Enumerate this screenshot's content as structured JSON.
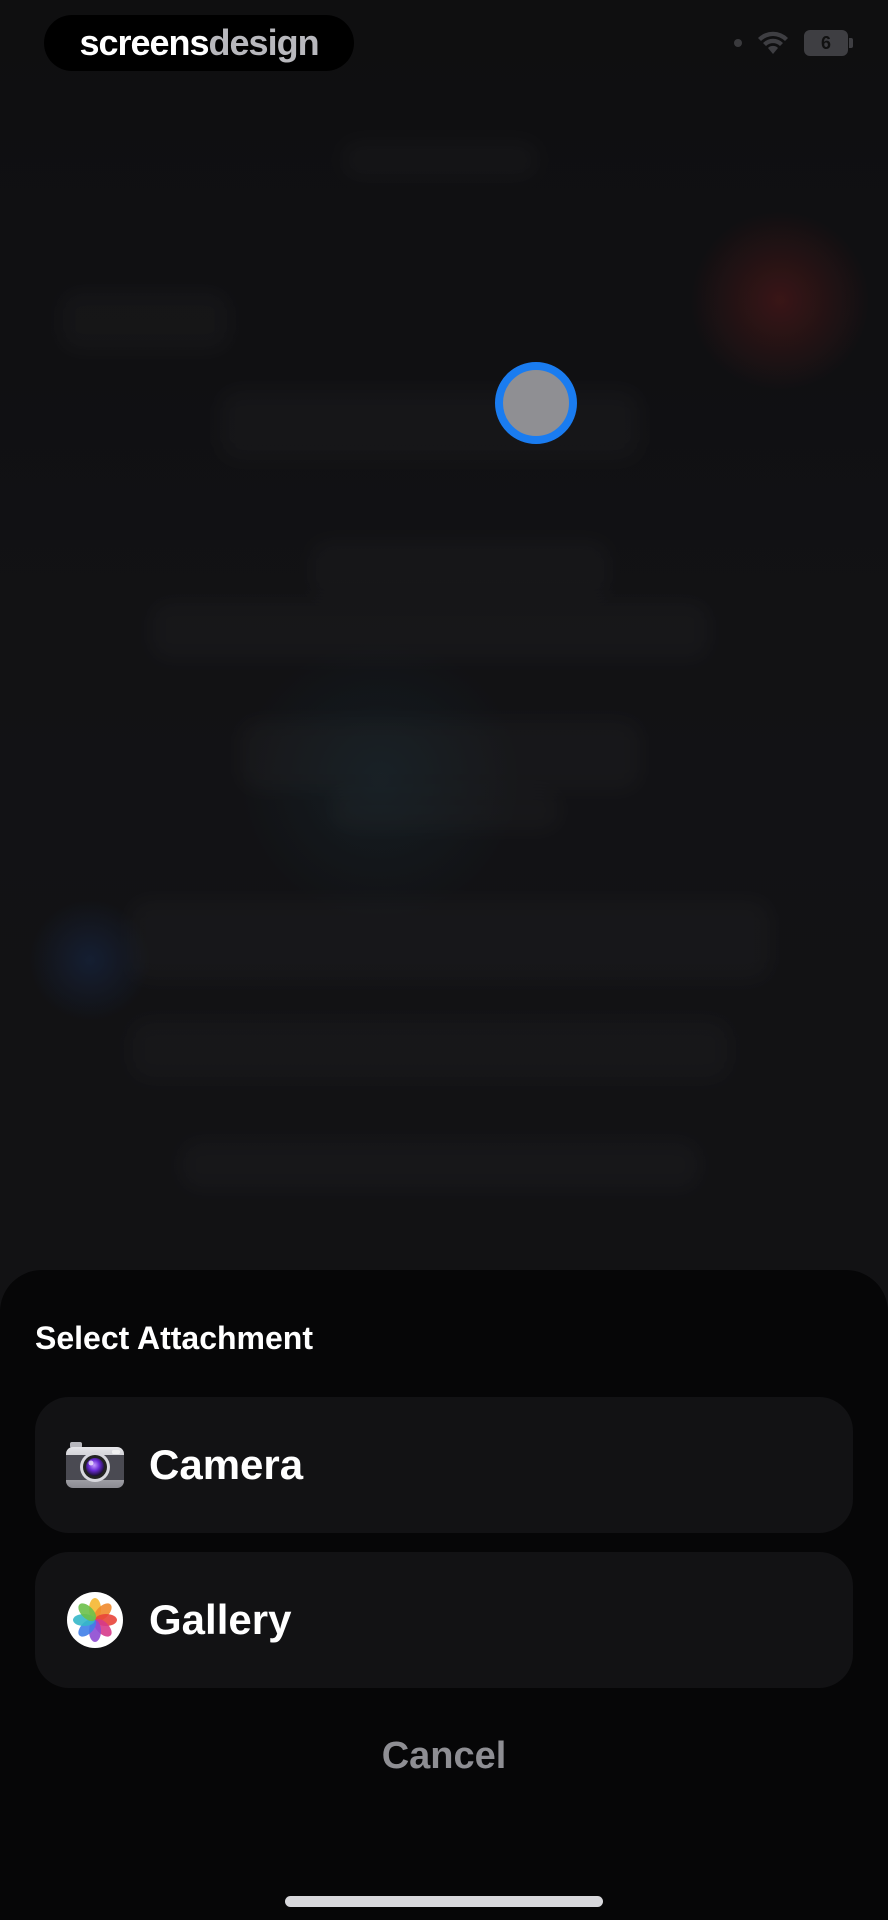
{
  "status_bar": {
    "brand_left": "screens",
    "brand_right": "design",
    "battery_level": "6"
  },
  "sheet": {
    "title": "Select Attachment",
    "options": [
      {
        "label": "Camera",
        "icon": "camera-icon"
      },
      {
        "label": "Gallery",
        "icon": "photos-icon"
      }
    ],
    "cancel_label": "Cancel"
  },
  "colors": {
    "touch_ring": "#1a7cf0",
    "sheet_background": "#060607",
    "option_background": "#121214",
    "cancel_text": "#8e8e93"
  }
}
